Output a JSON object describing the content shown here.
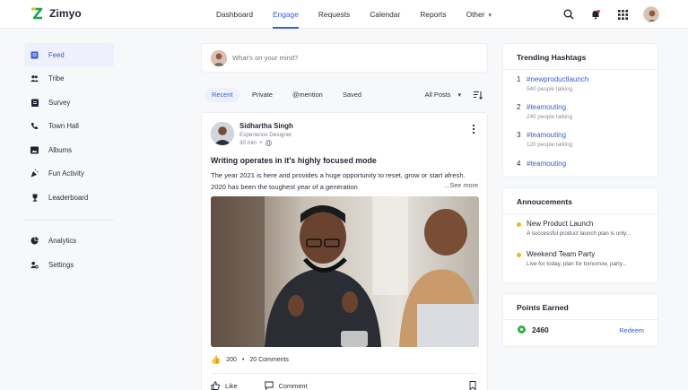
{
  "app": {
    "name": "Zimyo"
  },
  "nav": {
    "items": [
      {
        "label": "Dashboard"
      },
      {
        "label": "Engage"
      },
      {
        "label": "Requests"
      },
      {
        "label": "Calendar"
      },
      {
        "label": "Reports"
      },
      {
        "label": "Other"
      }
    ]
  },
  "sidebar": {
    "items": [
      {
        "label": "Feed",
        "icon": "feed-icon"
      },
      {
        "label": "Tribe",
        "icon": "people-icon"
      },
      {
        "label": "Survey",
        "icon": "clipboard-icon"
      },
      {
        "label": "Town Hall",
        "icon": "phone-icon"
      },
      {
        "label": "Albums",
        "icon": "image-icon"
      },
      {
        "label": "Fun Activity",
        "icon": "party-icon"
      },
      {
        "label": "Leaderboard",
        "icon": "trophy-icon"
      }
    ],
    "bottom_items": [
      {
        "label": "Analytics",
        "icon": "analytics-icon"
      },
      {
        "label": "Settings",
        "icon": "user-gear-icon"
      }
    ]
  },
  "composer": {
    "placeholder": "What's on your mind?"
  },
  "filters": {
    "tabs": [
      {
        "label": "Recent"
      },
      {
        "label": "Private"
      },
      {
        "label": "@mention"
      },
      {
        "label": "Saved"
      }
    ],
    "sort_label": "All Posts"
  },
  "post": {
    "author": "Sidhartha Singh",
    "role": "Experience Designer",
    "time": "30 min",
    "title": "Writing operates in it's highly focused mode",
    "body_line1": "The year 2021 is here and provides a huge opportunity to reset, grow or start afresh.",
    "body_line2": "2020 has been the toughest year of a generation",
    "see_more": "...See more",
    "reactions_count": "200",
    "comments": "20 Comments",
    "like_label": "Like",
    "comment_label": "Comment"
  },
  "trending": {
    "title": "Trending Hashtags",
    "items": [
      {
        "num": "1",
        "tag": "#newproductlaunch",
        "sub": "540 people talking"
      },
      {
        "num": "2",
        "tag": "#teamouting",
        "sub": "240 people talking"
      },
      {
        "num": "3",
        "tag": "#teamouting",
        "sub": "120 people talking"
      },
      {
        "num": "4",
        "tag": "#teamouting",
        "sub": ""
      }
    ]
  },
  "announcements": {
    "title": "Annoucements",
    "items": [
      {
        "title": "New Product Launch",
        "sub": "A successful product launch plan is only..."
      },
      {
        "title": "Weekend Team Party",
        "sub": "Live for today, plan for tomorrow, party..."
      }
    ]
  },
  "points": {
    "title": "Points Earned",
    "value": "2460",
    "redeem_label": "Redeem"
  },
  "colors": {
    "accent": "#3b5bdb",
    "announcement_dot": "#f0b71f",
    "points_green": "#2fb344"
  }
}
